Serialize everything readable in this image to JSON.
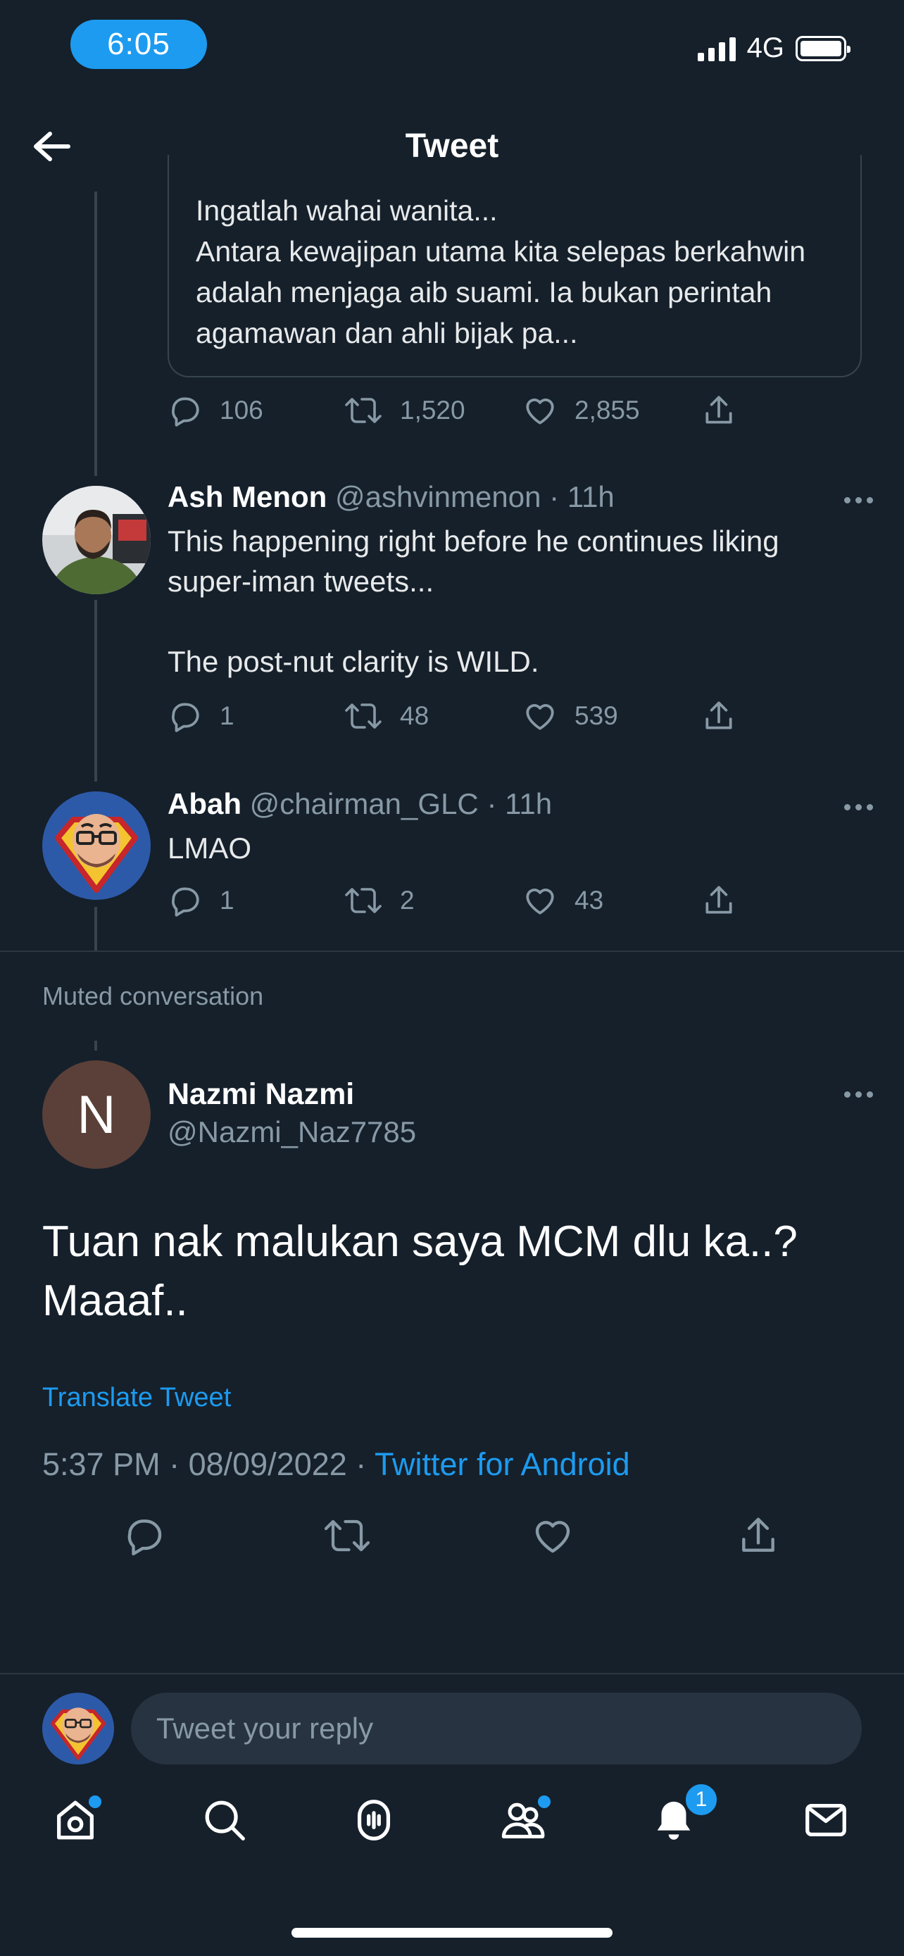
{
  "status_bar": {
    "time": "6:05",
    "network": "4G"
  },
  "header": {
    "title": "Tweet"
  },
  "quoted_tweet": {
    "text": "Ingatlah wahai wanita...\nAntara kewajipan utama kita selepas berkahwin adalah menjaga aib suami. Ia bukan perintah agamawan dan ahli bijak pa...",
    "replies": "106",
    "retweets": "1,520",
    "likes": "2,855"
  },
  "tweets": [
    {
      "name": "Ash Menon",
      "handle": "@ashvinmenon",
      "time": "· 11h",
      "text": "This happening right before he continues liking super-iman tweets...\n\nThe post-nut clarity is WILD.",
      "replies": "1",
      "retweets": "48",
      "likes": "539"
    },
    {
      "name": "Abah",
      "handle": "@chairman_GLC",
      "time": "· 11h",
      "text": "LMAO",
      "replies": "1",
      "retweets": "2",
      "likes": "43"
    }
  ],
  "muted_label": "Muted conversation",
  "main_tweet": {
    "avatar_letter": "N",
    "name": "Nazmi Nazmi",
    "handle": "@Nazmi_Naz7785",
    "text": "Tuan nak malukan saya MCM dlu ka..? Maaaf..",
    "translate": "Translate Tweet",
    "timestamp": "5:37 PM · 08/09/2022 · ",
    "source": "Twitter for Android"
  },
  "reply": {
    "placeholder": "Tweet your reply"
  },
  "tabbar": {
    "notifications_count": "1"
  },
  "colors": {
    "background": "#15202b",
    "accent": "#1d9bf0",
    "muted": "#8899a6"
  },
  "icons": [
    "back-arrow-icon",
    "reply-icon",
    "retweet-icon",
    "like-icon",
    "share-icon",
    "more-icon",
    "home-icon",
    "search-icon",
    "spaces-icon",
    "communities-icon",
    "notifications-icon",
    "messages-icon"
  ]
}
